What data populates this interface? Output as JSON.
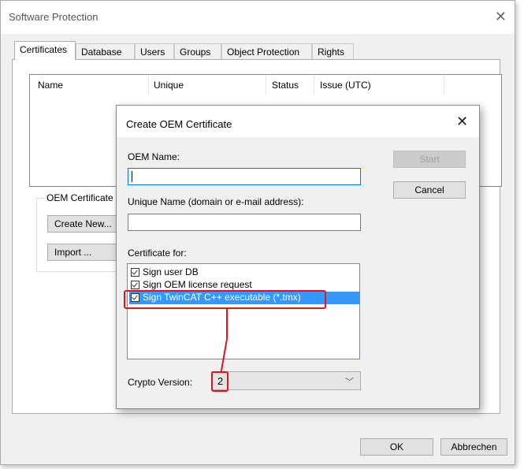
{
  "outer_dialog": {
    "title": "Software Protection",
    "tabs": [
      "Certificates",
      "Database",
      "Users",
      "Groups",
      "Object Protection",
      "Rights"
    ],
    "active_tab": "Certificates",
    "columns": [
      "Name",
      "Unique",
      "Status",
      "Issue (UTC)"
    ],
    "oem_group_label": "OEM Certificate",
    "create_new_label": "Create New...",
    "import_label": "Import ...",
    "ok_label": "OK",
    "cancel_label": "Abbrechen"
  },
  "inner_dialog": {
    "title": "Create OEM Certificate",
    "oem_name_label": "OEM Name:",
    "oem_name_value": "",
    "unique_name_label": "Unique Name (domain or e-mail address):",
    "unique_name_value": "",
    "certificate_for_label": "Certificate for:",
    "certificate_items": [
      {
        "label": "Sign user DB",
        "checked": true,
        "selected": false
      },
      {
        "label": "Sign OEM license request",
        "checked": true,
        "selected": false
      },
      {
        "label": "Sign TwinCAT C++ executable (*.tmx)",
        "checked": true,
        "selected": true
      }
    ],
    "crypto_version_label": "Crypto Version:",
    "crypto_version_value": "2",
    "start_label": "Start",
    "cancel_label": "Cancel"
  },
  "icons": {
    "close": "close-icon",
    "dropdown": "chevron-down-icon",
    "checkbox": "checkbox-checked-icon"
  },
  "colors": {
    "selection": "#3399ff",
    "annotation": "#e0141e",
    "focus_border": "#0078d7"
  }
}
